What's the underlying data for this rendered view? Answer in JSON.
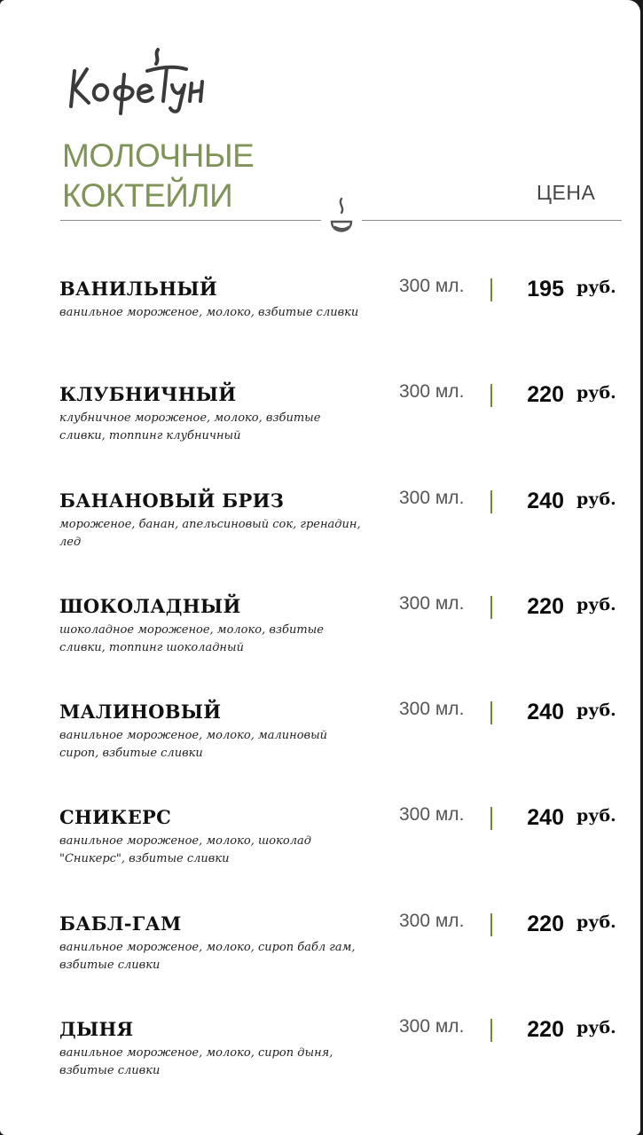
{
  "logo": {
    "text": "КофеТун",
    "icon": "kofetun-logo"
  },
  "heading": {
    "line1": "МОЛОЧНЫЕ",
    "line2": "КОКТЕЙЛИ"
  },
  "price_header": "ЦЕНА",
  "divider_icon": "cup-icon",
  "colors": {
    "accent": "#7f9458",
    "separator": "#6f8a3a",
    "text": "#111111"
  },
  "items": [
    {
      "name": "ВАНИЛЬНЫЙ",
      "desc": "ванильное мороженое, молоко, взбитые сливки",
      "volume": "300 мл.",
      "price": "195",
      "currency": "руб."
    },
    {
      "name": "КЛУБНИЧНЫЙ",
      "desc": "клубничное мороженое, молоко, взбитые сливки, топпинг клубничный",
      "volume": "300 мл.",
      "price": "220",
      "currency": "руб."
    },
    {
      "name": "БАНАНОВЫЙ БРИЗ",
      "desc": "мороженое, банан, апельсиновый сок, гренадин, лед",
      "volume": "300 мл.",
      "price": "240",
      "currency": "руб."
    },
    {
      "name": "ШОКОЛАДНЫЙ",
      "desc": "шоколадное мороженое, молоко, взбитые сливки, топпинг шоколадный",
      "volume": "300 мл.",
      "price": "220",
      "currency": "руб."
    },
    {
      "name": "МАЛИНОВЫЙ",
      "desc": "ванильное мороженое, молоко, малиновый сироп, взбитые сливки",
      "volume": "300 мл.",
      "price": "240",
      "currency": "руб."
    },
    {
      "name": "СНИКЕРС",
      "desc": "ванильное мороженое, молоко, шоколад \"Сникерс\", взбитые сливки",
      "volume": "300 мл.",
      "price": "240",
      "currency": "руб."
    },
    {
      "name": "БАБЛ-ГАМ",
      "desc": "ванильное мороженое, молоко, сироп бабл гам, взбитые сливки",
      "volume": "300 мл.",
      "price": "220",
      "currency": "руб."
    },
    {
      "name": "ДЫНЯ",
      "desc": "ванильное мороженое, молоко, сироп дыня, взбитые сливки",
      "volume": "300 мл.",
      "price": "220",
      "currency": "руб."
    }
  ]
}
